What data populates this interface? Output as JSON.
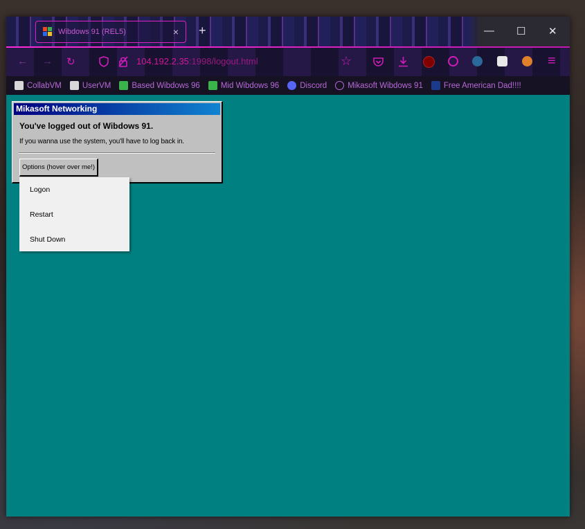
{
  "window": {
    "tab_title": "Wibdows 91 (REL5)",
    "tab_close": "×",
    "new_tab": "+",
    "minimize": "—",
    "maximize": "☐",
    "close": "✕"
  },
  "navbar": {
    "back": "←",
    "forward": "→",
    "reload": "↻",
    "url_host": "104.192.2.35",
    "url_path": ":1998/logout.html",
    "star": "☆",
    "menu": "≡"
  },
  "bookmarks": [
    {
      "label": "CollabVM",
      "icon": "computer-icon",
      "color": "#d8d8d8"
    },
    {
      "label": "UserVM",
      "icon": "computer-icon",
      "color": "#d8d8d8"
    },
    {
      "label": "Based Wibdows 96",
      "icon": "windows-logo-icon",
      "color": "#3ab34a"
    },
    {
      "label": "Mid Wibdows 96",
      "icon": "windows-logo-icon",
      "color": "#3ab34a"
    },
    {
      "label": "Discord",
      "icon": "discord-icon",
      "color": "#5865f2"
    },
    {
      "label": "Mikasoft Wibdows 91",
      "icon": "globe-icon",
      "color": "#b66ad6"
    },
    {
      "label": "Free American Dad!!!!",
      "icon": "disney-icon",
      "color": "#1b3a8a"
    }
  ],
  "dialog": {
    "title": "Mikasoft Networking",
    "heading": "You've logged out of Wibdows 91.",
    "message": "If you wanna use the system, you'll have to log back in.",
    "options_button": "Options (hover over me!)"
  },
  "menu": {
    "items": [
      "Logon",
      "Restart",
      "Shut Down"
    ]
  },
  "colors": {
    "desktop": "#008080",
    "accent": "#d01cb8",
    "dialog_title": "#000080"
  }
}
